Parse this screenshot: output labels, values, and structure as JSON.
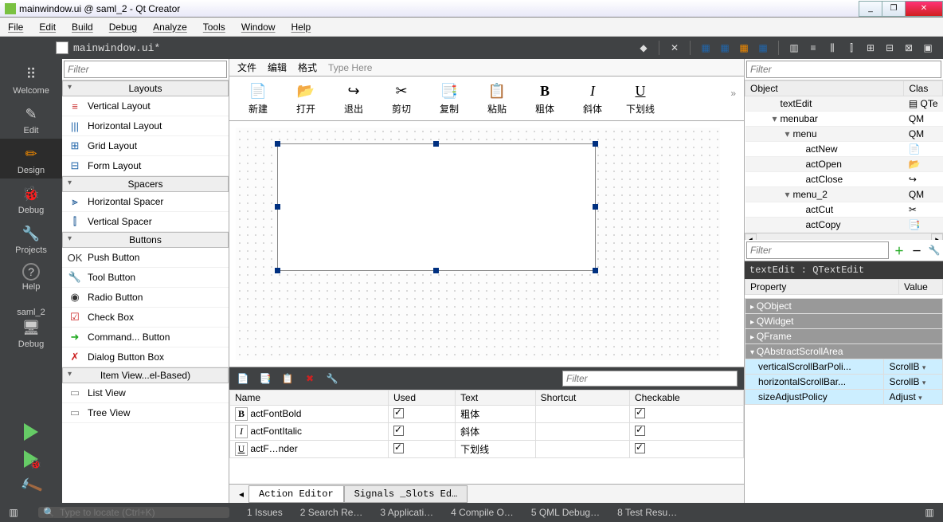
{
  "window": {
    "title": "mainwindow.ui @ saml_2 - Qt Creator",
    "min": "_",
    "max": "❐",
    "close": "✕"
  },
  "menubar": [
    "File",
    "Edit",
    "Build",
    "Debug",
    "Analyze",
    "Tools",
    "Window",
    "Help"
  ],
  "open_file": "mainwindow.ui*",
  "modes": [
    {
      "label": "Welcome",
      "icon": "⠿"
    },
    {
      "label": "Edit",
      "icon": "✎"
    },
    {
      "label": "Design",
      "icon": "✏",
      "active": true
    },
    {
      "label": "Debug",
      "icon": "🐞"
    },
    {
      "label": "Projects",
      "icon": "🔧"
    },
    {
      "label": "Help",
      "icon": "?"
    }
  ],
  "kit": {
    "name": "saml_2",
    "target": "Debug",
    "monitor": "🖥"
  },
  "widgetbox": {
    "filter": "Filter",
    "groups": [
      {
        "title": "Layouts",
        "items": [
          {
            "icon": "≡",
            "color": "#c33",
            "label": "Vertical Layout"
          },
          {
            "icon": "|||",
            "color": "#26a",
            "label": "Horizontal Layout"
          },
          {
            "icon": "⊞",
            "color": "#26a",
            "label": "Grid Layout"
          },
          {
            "icon": "⊟",
            "color": "#26a",
            "label": "Form Layout"
          }
        ]
      },
      {
        "title": "Spacers",
        "items": [
          {
            "icon": "⫸",
            "color": "#048",
            "label": "Horizontal Spacer"
          },
          {
            "icon": "⫿",
            "color": "#048",
            "label": "Vertical Spacer"
          }
        ]
      },
      {
        "title": "Buttons",
        "items": [
          {
            "icon": "OK",
            "color": "#333",
            "label": "Push Button"
          },
          {
            "icon": "🔧",
            "color": "#555",
            "label": "Tool Button"
          },
          {
            "icon": "◉",
            "color": "#333",
            "label": "Radio Button"
          },
          {
            "icon": "☑",
            "color": "#c22",
            "label": "Check Box"
          },
          {
            "icon": "➜",
            "color": "#2a2",
            "label": "Command... Button"
          },
          {
            "icon": "✗",
            "color": "#c22",
            "label": "Dialog Button Box"
          }
        ]
      },
      {
        "title": "Item View...el-Based)",
        "items": [
          {
            "icon": "▭",
            "color": "#888",
            "label": "List View"
          },
          {
            "icon": "▭",
            "color": "#888",
            "label": "Tree View"
          }
        ]
      }
    ]
  },
  "designer": {
    "menus": [
      "文件",
      "编辑",
      "格式",
      "Type Here"
    ],
    "toolbar": [
      {
        "icon": "📄",
        "label": "新建"
      },
      {
        "icon": "📂",
        "label": "打开"
      },
      {
        "icon": "↪",
        "label": "退出"
      },
      {
        "icon": "✂",
        "label": "剪切"
      },
      {
        "icon": "📑",
        "label": "复制"
      },
      {
        "icon": "📋",
        "label": "粘贴"
      },
      {
        "icon": "B",
        "label": "粗体",
        "bold": true
      },
      {
        "icon": "I",
        "label": "斜体",
        "italic": true
      },
      {
        "icon": "U",
        "label": "下划线",
        "underline": true
      }
    ],
    "more": "»"
  },
  "action_editor": {
    "filter": "Filter",
    "columns": [
      "Name",
      "Used",
      "Text",
      "Shortcut",
      "Checkable"
    ],
    "rows": [
      {
        "icon": "B",
        "name": "actFontBold",
        "used": true,
        "text": "粗体",
        "shortcut": "",
        "checkable": true
      },
      {
        "icon": "I",
        "name": "actFontItalic",
        "used": true,
        "text": "斜体",
        "shortcut": "",
        "checkable": true
      },
      {
        "icon": "U",
        "name": "actF…nder",
        "used": true,
        "text": "下划线",
        "shortcut": "",
        "checkable": true
      }
    ],
    "tabs": [
      "Action Editor",
      "Signals _Slots Ed…"
    ]
  },
  "object_inspector": {
    "filter": "Filter",
    "columns": [
      "Object",
      "Clas"
    ],
    "rows": [
      {
        "name": "textEdit",
        "cls": "QTe",
        "indent": 1,
        "icon": "▤"
      },
      {
        "name": "menubar",
        "cls": "QM",
        "indent": 1,
        "exp": "▾"
      },
      {
        "name": "menu",
        "cls": "QM",
        "indent": 2,
        "exp": "▾"
      },
      {
        "name": "actNew",
        "cls": "",
        "indent": 3,
        "icon": "📄"
      },
      {
        "name": "actOpen",
        "cls": "",
        "indent": 3,
        "icon": "📂"
      },
      {
        "name": "actClose",
        "cls": "",
        "indent": 3,
        "icon": "↪"
      },
      {
        "name": "menu_2",
        "cls": "QM",
        "indent": 2,
        "exp": "▾"
      },
      {
        "name": "actCut",
        "cls": "",
        "indent": 3,
        "icon": "✂"
      },
      {
        "name": "actCopy",
        "cls": "",
        "indent": 3,
        "icon": "📑"
      }
    ]
  },
  "properties": {
    "filter": "Filter",
    "header": "textEdit : QTextEdit",
    "columns": [
      "Property",
      "Value"
    ],
    "groups": [
      {
        "name": "QObject",
        "open": false
      },
      {
        "name": "QWidget",
        "open": false
      },
      {
        "name": "QFrame",
        "open": false
      },
      {
        "name": "QAbstractScrollArea",
        "open": true,
        "rows": [
          {
            "name": "verticalScrollBarPoli...",
            "value": "ScrollB"
          },
          {
            "name": "horizontalScrollBar...",
            "value": "ScrollB"
          },
          {
            "name": "sizeAdjustPolicy",
            "value": "Adjust"
          }
        ]
      }
    ]
  },
  "status": {
    "locate_placeholder": "Type to locate (Ctrl+K)",
    "items": [
      "1  Issues",
      "2  Search Re…",
      "3  Applicati…",
      "4  Compile O…",
      "5  QML Debug…",
      "8  Test Resu…"
    ]
  }
}
